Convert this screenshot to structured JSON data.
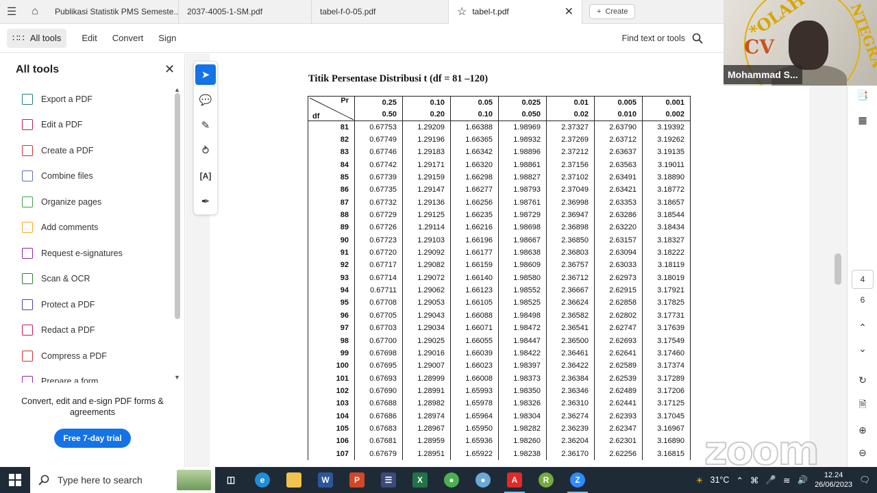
{
  "tabs": [
    {
      "label": "Publikasi Statistik PMS Semeste..."
    },
    {
      "label": "2037-4005-1-SM.pdf"
    },
    {
      "label": "tabel-f-0-05.pdf"
    },
    {
      "label": "tabel-t.pdf"
    }
  ],
  "create_label": "Create",
  "toolbar": {
    "all_tools": "All tools",
    "edit": "Edit",
    "convert": "Convert",
    "sign": "Sign",
    "find": "Find text or tools"
  },
  "left_panel": {
    "title": "All tools",
    "tools": [
      {
        "label": "Export a PDF",
        "icon": "export-pdf-icon",
        "color": "#1b7f79"
      },
      {
        "label": "Edit a PDF",
        "icon": "edit-pdf-icon",
        "color": "#c2185b"
      },
      {
        "label": "Create a PDF",
        "icon": "create-pdf-icon",
        "color": "#d32f2f"
      },
      {
        "label": "Combine files",
        "icon": "combine-files-icon",
        "color": "#5c6bc0"
      },
      {
        "label": "Organize pages",
        "icon": "organize-pages-icon",
        "color": "#43a047"
      },
      {
        "label": "Add comments",
        "icon": "add-comments-icon",
        "color": "#f9a825"
      },
      {
        "label": "Request e-signatures",
        "icon": "request-signature-icon",
        "color": "#8e24aa"
      },
      {
        "label": "Scan & OCR",
        "icon": "scan-ocr-icon",
        "color": "#2e7d32"
      },
      {
        "label": "Protect a PDF",
        "icon": "protect-pdf-icon",
        "color": "#5e35b1"
      },
      {
        "label": "Redact a PDF",
        "icon": "redact-pdf-icon",
        "color": "#c2185b"
      },
      {
        "label": "Compress a PDF",
        "icon": "compress-pdf-icon",
        "color": "#d32f2f"
      },
      {
        "label": "Prepare a form",
        "icon": "prepare-form-icon",
        "color": "#8e24aa"
      }
    ],
    "promo": "Convert, edit and e-sign PDF forms & agreements",
    "trial_button": "Free 7-day trial"
  },
  "document": {
    "title": "Titik Persentase Distribusi t (df = 81 –120)",
    "header_pr": "Pr",
    "header_df": "df",
    "header_row1": [
      "0.25",
      "0.10",
      "0.05",
      "0.025",
      "0.01",
      "0.005",
      "0.001"
    ],
    "header_row2": [
      "0.50",
      "0.20",
      "0.10",
      "0.050",
      "0.02",
      "0.010",
      "0.002"
    ],
    "rows": [
      [
        "81",
        "0.67753",
        "1.29209",
        "1.66388",
        "1.98969",
        "2.37327",
        "2.63790",
        "3.19392"
      ],
      [
        "82",
        "0.67749",
        "1.29196",
        "1.66365",
        "1.98932",
        "2.37269",
        "2.63712",
        "3.19262"
      ],
      [
        "83",
        "0.67746",
        "1.29183",
        "1.66342",
        "1.98896",
        "2.37212",
        "2.63637",
        "3.19135"
      ],
      [
        "84",
        "0.67742",
        "1.29171",
        "1.66320",
        "1.98861",
        "2.37156",
        "2.63563",
        "3.19011"
      ],
      [
        "85",
        "0.67739",
        "1.29159",
        "1.66298",
        "1.98827",
        "2.37102",
        "2.63491",
        "3.18890"
      ],
      [
        "86",
        "0.67735",
        "1.29147",
        "1.66277",
        "1.98793",
        "2.37049",
        "2.63421",
        "3.18772"
      ],
      [
        "87",
        "0.67732",
        "1.29136",
        "1.66256",
        "1.98761",
        "2.36998",
        "2.63353",
        "3.18657"
      ],
      [
        "88",
        "0.67729",
        "1.29125",
        "1.66235",
        "1.98729",
        "2.36947",
        "2.63286",
        "3.18544"
      ],
      [
        "89",
        "0.67726",
        "1.29114",
        "1.66216",
        "1.98698",
        "2.36898",
        "2.63220",
        "3.18434"
      ],
      [
        "90",
        "0.67723",
        "1.29103",
        "1.66196",
        "1.98667",
        "2.36850",
        "2.63157",
        "3.18327"
      ],
      [
        "91",
        "0.67720",
        "1.29092",
        "1.66177",
        "1.98638",
        "2.36803",
        "2.63094",
        "3.18222"
      ],
      [
        "92",
        "0.67717",
        "1.29082",
        "1.66159",
        "1.98609",
        "2.36757",
        "2.63033",
        "3.18119"
      ],
      [
        "93",
        "0.67714",
        "1.29072",
        "1.66140",
        "1.98580",
        "2.36712",
        "2.62973",
        "3.18019"
      ],
      [
        "94",
        "0.67711",
        "1.29062",
        "1.66123",
        "1.98552",
        "2.36667",
        "2.62915",
        "3.17921"
      ],
      [
        "95",
        "0.67708",
        "1.29053",
        "1.66105",
        "1.98525",
        "2.36624",
        "2.62858",
        "3.17825"
      ],
      [
        "96",
        "0.67705",
        "1.29043",
        "1.66088",
        "1.98498",
        "2.36582",
        "2.62802",
        "3.17731"
      ],
      [
        "97",
        "0.67703",
        "1.29034",
        "1.66071",
        "1.98472",
        "2.36541",
        "2.62747",
        "3.17639"
      ],
      [
        "98",
        "0.67700",
        "1.29025",
        "1.66055",
        "1.98447",
        "2.36500",
        "2.62693",
        "3.17549"
      ],
      [
        "99",
        "0.67698",
        "1.29016",
        "1.66039",
        "1.98422",
        "2.36461",
        "2.62641",
        "3.17460"
      ],
      [
        "100",
        "0.67695",
        "1.29007",
        "1.66023",
        "1.98397",
        "2.36422",
        "2.62589",
        "3.17374"
      ],
      [
        "101",
        "0.67693",
        "1.28999",
        "1.66008",
        "1.98373",
        "2.36384",
        "2.62539",
        "3.17289"
      ],
      [
        "102",
        "0.67690",
        "1.28991",
        "1.65993",
        "1.98350",
        "2.36346",
        "2.62489",
        "3.17206"
      ],
      [
        "103",
        "0.67688",
        "1.28982",
        "1.65978",
        "1.98326",
        "2.36310",
        "2.62441",
        "3.17125"
      ],
      [
        "104",
        "0.67686",
        "1.28974",
        "1.65964",
        "1.98304",
        "2.36274",
        "2.62393",
        "3.17045"
      ],
      [
        "105",
        "0.67683",
        "1.28967",
        "1.65950",
        "1.98282",
        "2.36239",
        "2.62347",
        "3.16967"
      ],
      [
        "106",
        "0.67681",
        "1.28959",
        "1.65936",
        "1.98260",
        "2.36204",
        "2.62301",
        "3.16890"
      ],
      [
        "107",
        "0.67679",
        "1.28951",
        "1.65922",
        "1.98238",
        "2.36170",
        "2.62256",
        "3.16815"
      ]
    ]
  },
  "page_nav": {
    "current": "4",
    "total": "6"
  },
  "webcam": {
    "name": "Mohammad S...",
    "logo_text": "*OLAH",
    "logo_cv": "CV",
    "logo_right": "NTEGRA"
  },
  "watermark": "zoom",
  "taskbar": {
    "search_placeholder": "Type here to search",
    "weather": "31°C",
    "time": "12.24",
    "date": "26/06/2023"
  }
}
